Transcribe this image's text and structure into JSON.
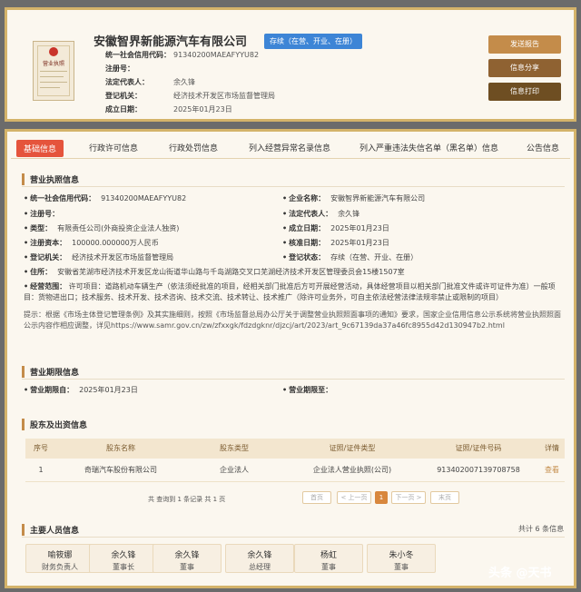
{
  "header": {
    "company_name": "安徽智界新能源汽车有限公司",
    "status_tag": "存续（在营、开业、在册）",
    "info": [
      {
        "label": "统一社会信用代码：",
        "value": "91340200MAEAFYYU82"
      },
      {
        "label": "注册号：",
        "value": ""
      },
      {
        "label": "法定代表人：",
        "value": "余久锋"
      },
      {
        "label": "登记机关：",
        "value": "经济技术开发区市场监督管理局"
      },
      {
        "label": "成立日期：",
        "value": "2025年01月23日"
      }
    ],
    "license_caption": "营业执照",
    "buttons": {
      "report": "发送报告",
      "share": "信息分享",
      "print": "信息打印"
    }
  },
  "tabs": [
    "基础信息",
    "行政许可信息",
    "行政处罚信息",
    "列入经营异常名录信息",
    "列入严重违法失信名单（黑名单）信息",
    "公告信息"
  ],
  "license_section": {
    "title": "营业执照信息",
    "left": [
      {
        "label": "统一社会信用代码：",
        "value": "91340200MAEAFYYU82"
      },
      {
        "label": "注册号：",
        "value": ""
      },
      {
        "label": "类型：",
        "value": "有限责任公司(外商投资企业法人独资)"
      },
      {
        "label": "注册资本：",
        "value": "100000.000000万人民币"
      },
      {
        "label": "登记机关：",
        "value": "经济技术开发区市场监督管理局"
      }
    ],
    "right": [
      {
        "label": "企业名称：",
        "value": "安徽智界新能源汽车有限公司"
      },
      {
        "label": "法定代表人：",
        "value": "余久锋"
      },
      {
        "label": "成立日期：",
        "value": "2025年01月23日"
      },
      {
        "label": "核准日期：",
        "value": "2025年01月23日"
      },
      {
        "label": "登记状态：",
        "value": "存续（在营、开业、在册）"
      }
    ],
    "address_label": "住所：",
    "address": "安徽省芜湖市经济技术开发区龙山街道华山路与千岛湖路交叉口芜湖经济技术开发区管理委员会15楼1507室",
    "scope_label": "经营范围：",
    "scope": "许可项目：道路机动车辆生产（依法须经批准的项目，经相关部门批准后方可开展经营活动，具体经营项目以相关部门批准文件或许可证件为准）一般项目：货物进出口；技术服务、技术开发、技术咨询、技术交流、技术转让、技术推广（除许可业务外，可自主依法经营法律法规非禁止或限制的项目）",
    "notice": "提示：根据《市场主体登记管理条例》及其实施细则，按照《市场监督总局办公厅关于调整营业执照照面事项的通知》要求，国家企业信用信息公示系统将营业执照照面公示内容作相应调整，详见https://www.samr.gov.cn/zw/zfxxgk/fdzdgknr/djzcj/art/2023/art_9c67139da37a46fc8955d42d130947b2.html"
  },
  "term_section": {
    "title": "营业期限信息",
    "from_label": "营业期限自：",
    "from_value": "2025年01月23日",
    "to_label": "营业期限至：",
    "to_value": ""
  },
  "shareholder_section": {
    "title": "股东及出资信息",
    "columns": [
      "序号",
      "股东名称",
      "股东类型",
      "证照/证件类型",
      "证照/证件号码",
      "详情"
    ],
    "rows": [
      [
        "1",
        "奇瑞汽车股份有限公司",
        "企业法人",
        "企业法人营业执照(公司)",
        "913402007139708758",
        "查看"
      ]
    ],
    "pager_info": "共 查询到 1 条记录 共 1 页",
    "pager": {
      "first": "首页",
      "prev": "< 上一页",
      "current": "1",
      "next": "下一页 >",
      "last": "末页"
    }
  },
  "people_section": {
    "title": "主要人员信息",
    "total": "共计 6 条信息",
    "people": [
      {
        "name": "喻筱娜",
        "role": "财务负责人"
      },
      {
        "name": "余久锋",
        "role": "董事长"
      },
      {
        "name": "余久锋",
        "role": "董事"
      },
      {
        "name": "余久锋",
        "role": "总经理"
      },
      {
        "name": "杨虹",
        "role": "董事"
      },
      {
        "name": "朱小冬",
        "role": "董事"
      }
    ]
  },
  "watermark": "头条 @天书"
}
